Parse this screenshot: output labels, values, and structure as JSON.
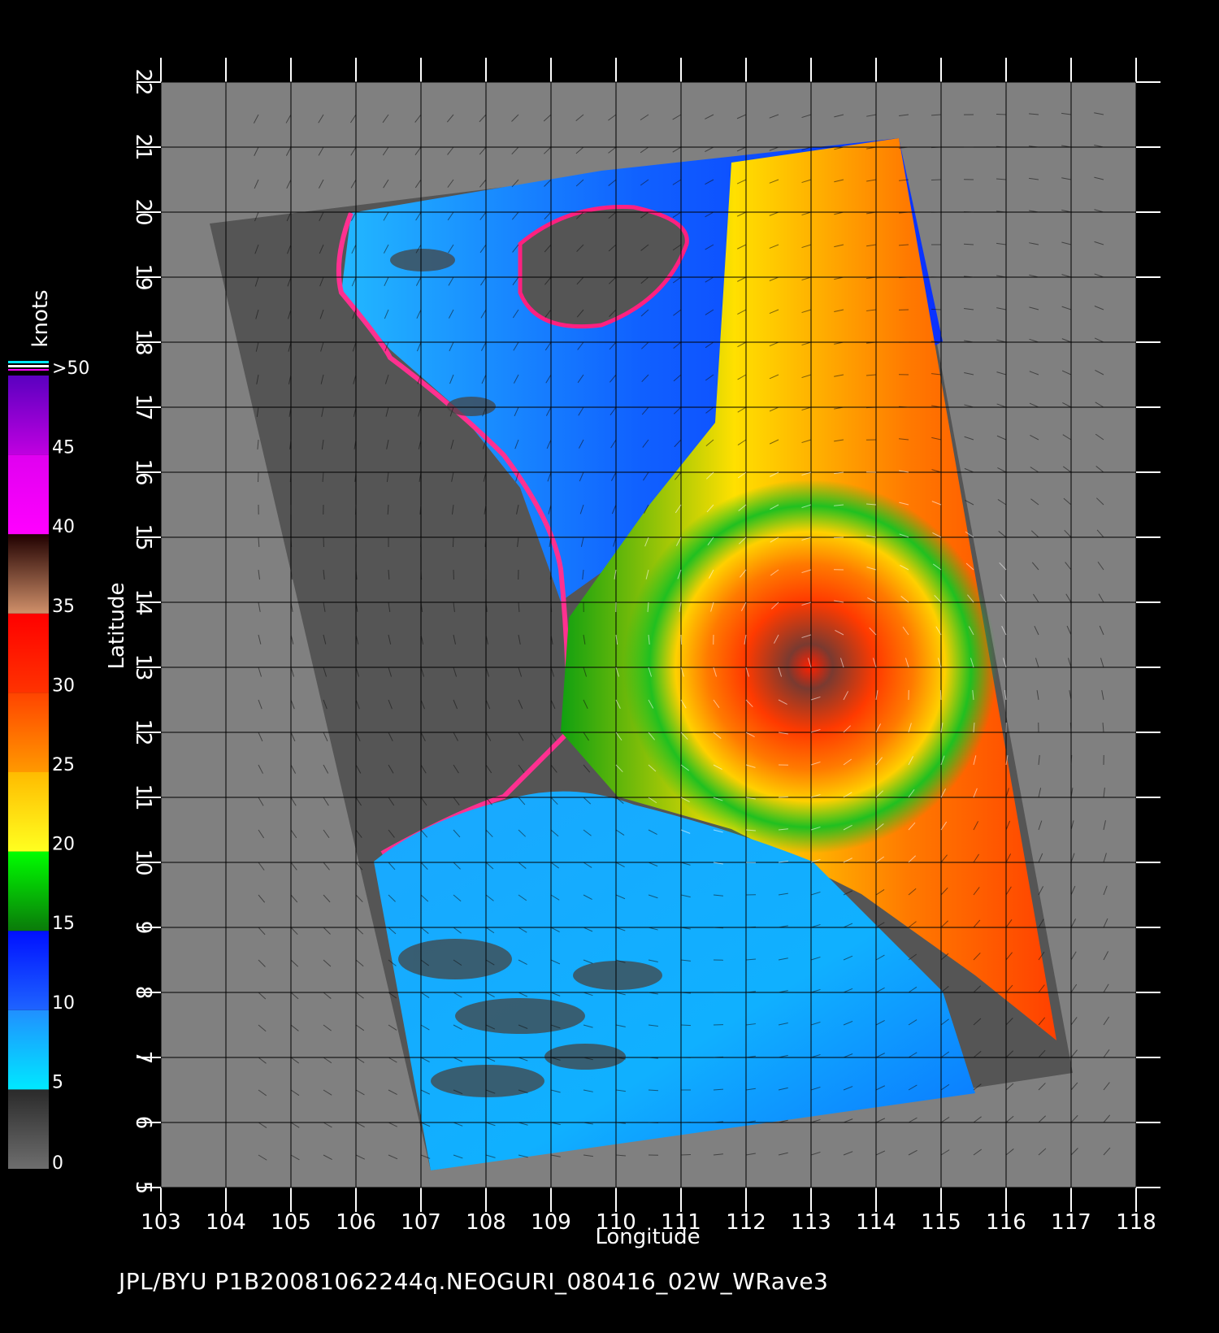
{
  "map": {
    "x_axis_label": "Longitude",
    "y_axis_label": "Latitude",
    "lon_range": [
      103,
      118
    ],
    "lat_range": [
      5,
      22
    ],
    "lon_ticks": [
      "103",
      "104",
      "105",
      "106",
      "107",
      "108",
      "109",
      "110",
      "111",
      "112",
      "113",
      "114",
      "115",
      "116",
      "117",
      "118"
    ],
    "lat_ticks": [
      "5",
      "6",
      "7",
      "8",
      "9",
      "10",
      "11",
      "12",
      "13",
      "14",
      "15",
      "16",
      "17",
      "18",
      "19",
      "20",
      "21",
      "22"
    ],
    "background_color": "#808080",
    "land_color": "#555555",
    "storm_center": {
      "lon": 113.0,
      "lat": 13.0
    }
  },
  "colorbar": {
    "unit_label": "knots",
    "tick_labels": [
      "0",
      "5",
      "10",
      "15",
      "20",
      "25",
      "30",
      "35",
      "40",
      "45",
      ">50"
    ],
    "bands": [
      {
        "from": 0,
        "to": 5,
        "colors": [
          "#6e6e6e",
          "#2a2a2a"
        ]
      },
      {
        "from": 5,
        "to": 10,
        "colors": [
          "#00e8ff",
          "#2090ff"
        ]
      },
      {
        "from": 10,
        "to": 15,
        "colors": [
          "#1e64ff",
          "#0010ff"
        ]
      },
      {
        "from": 15,
        "to": 20,
        "colors": [
          "#0a7a0a",
          "#00ff00"
        ]
      },
      {
        "from": 20,
        "to": 25,
        "colors": [
          "#ffff20",
          "#ffbb00"
        ]
      },
      {
        "from": 25,
        "to": 30,
        "colors": [
          "#ff9900",
          "#ff4400"
        ]
      },
      {
        "from": 30,
        "to": 35,
        "colors": [
          "#ff3300",
          "#ff0000"
        ]
      },
      {
        "from": 35,
        "to": 40,
        "colors": [
          "#d0906a",
          "#200000"
        ]
      },
      {
        "from": 40,
        "to": 45,
        "colors": [
          "#ff00ff",
          "#e000f0"
        ]
      },
      {
        "from": 45,
        "to": 50,
        "colors": [
          "#c000e0",
          "#5a00c0"
        ]
      }
    ]
  },
  "footer_text": "JPL/BYU  P1B20081062244q.NEOGURI_080416_02W_WRave3"
}
